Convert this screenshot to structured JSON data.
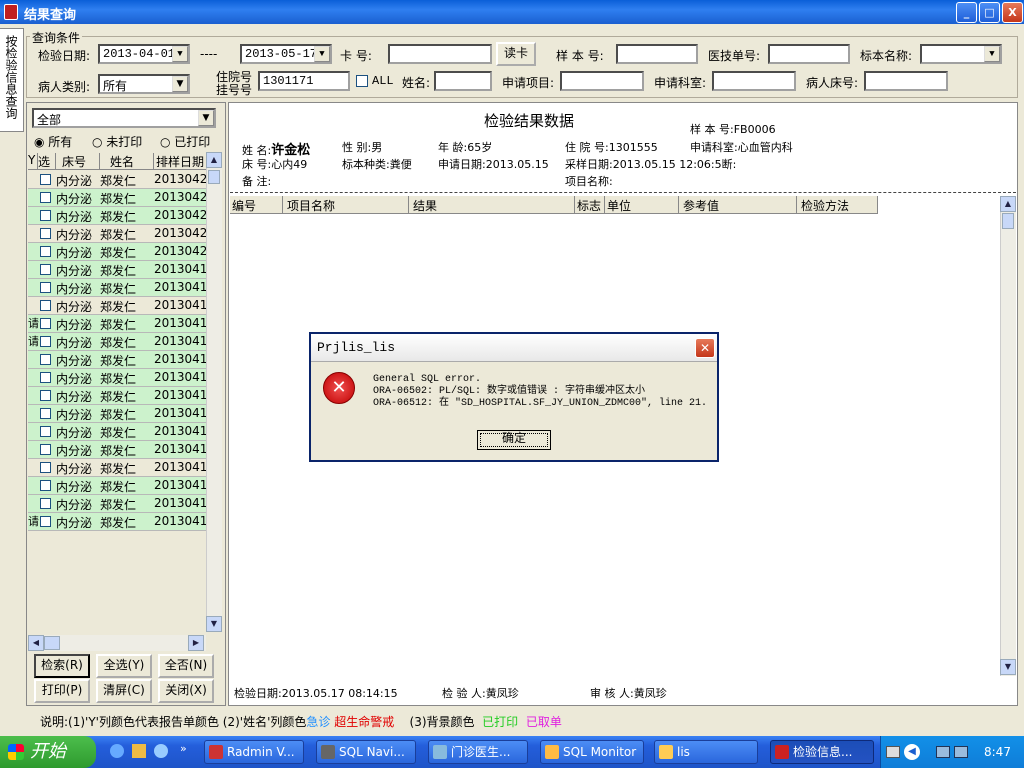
{
  "window": {
    "title": "结果查询",
    "min": "_",
    "max": "□",
    "close": "X"
  },
  "vtab": "按检验信息查询",
  "group_title": "查询条件",
  "row1": {
    "date_label": "检验日期:",
    "date_from": "2013-04-01",
    "dash": "----",
    "date_to": "2013-05-17",
    "card_label": "卡  号:",
    "card_value": "",
    "read_card": "读卡",
    "sample_label": "样 本 号:",
    "sample_value": "",
    "tech_label": "医技单号:",
    "tech_value": "",
    "specimen_label": "标本名称:",
    "specimen_value": ""
  },
  "row2": {
    "patient_type_label": "病人类别:",
    "patient_type": "所有",
    "hosp_label_top": "住院号",
    "hosp_label_bottom": "挂号号",
    "hosp_value": "1301171",
    "all_label": "ALL",
    "name_label": "姓名:",
    "name_value": "",
    "req_item_label": "申请项目:",
    "req_item_value": "",
    "req_dept_label": "申请科室:",
    "req_dept_value": "",
    "bed_label": "病人床号:",
    "bed_value": ""
  },
  "left": {
    "dept": "全部",
    "radio_all": "所有",
    "radio_unprinted": "未打印",
    "radio_printed": "已打印",
    "headers": [
      "Y",
      "选",
      "床号",
      "姓名",
      "排样日期"
    ],
    "rows": [
      {
        "y": "",
        "bed": "内分泌",
        "name": "郑发仁",
        "date": "2013042",
        "color": "b"
      },
      {
        "y": "",
        "bed": "内分泌",
        "name": "郑发仁",
        "date": "2013042",
        "color": "g"
      },
      {
        "y": "",
        "bed": "内分泌",
        "name": "郑发仁",
        "date": "2013042",
        "color": "g"
      },
      {
        "y": "",
        "bed": "内分泌",
        "name": "郑发仁",
        "date": "2013042",
        "color": "b"
      },
      {
        "y": "",
        "bed": "内分泌",
        "name": "郑发仁",
        "date": "2013042",
        "color": "g"
      },
      {
        "y": "",
        "bed": "内分泌",
        "name": "郑发仁",
        "date": "2013041",
        "color": "g"
      },
      {
        "y": "",
        "bed": "内分泌",
        "name": "郑发仁",
        "date": "2013041",
        "color": "g"
      },
      {
        "y": "",
        "bed": "内分泌",
        "name": "郑发仁",
        "date": "2013041",
        "color": "b"
      },
      {
        "y": "请",
        "bed": "内分泌",
        "name": "郑发仁",
        "date": "2013041",
        "color": "g"
      },
      {
        "y": "请",
        "bed": "内分泌",
        "name": "郑发仁",
        "date": "2013041",
        "color": "g"
      },
      {
        "y": "",
        "bed": "内分泌",
        "name": "郑发仁",
        "date": "2013041",
        "color": "g"
      },
      {
        "y": "",
        "bed": "内分泌",
        "name": "郑发仁",
        "date": "2013041",
        "color": "g"
      },
      {
        "y": "",
        "bed": "内分泌",
        "name": "郑发仁",
        "date": "2013041",
        "color": "g"
      },
      {
        "y": "",
        "bed": "内分泌",
        "name": "郑发仁",
        "date": "2013041",
        "color": "g"
      },
      {
        "y": "",
        "bed": "内分泌",
        "name": "郑发仁",
        "date": "2013041",
        "color": "g"
      },
      {
        "y": "",
        "bed": "内分泌",
        "name": "郑发仁",
        "date": "2013041",
        "color": "g"
      },
      {
        "y": "",
        "bed": "内分泌",
        "name": "郑发仁",
        "date": "2013041",
        "color": "b"
      },
      {
        "y": "",
        "bed": "内分泌",
        "name": "郑发仁",
        "date": "2013041",
        "color": "g"
      },
      {
        "y": "",
        "bed": "内分泌",
        "name": "郑发仁",
        "date": "2013041",
        "color": "g"
      },
      {
        "y": "请",
        "bed": "内分泌",
        "name": "郑发仁",
        "date": "2013041",
        "color": "g"
      }
    ],
    "btn_search": "检索(R)",
    "btn_select_all": "全选(Y)",
    "btn_select_none": "全否(N)",
    "btn_print": "打印(P)",
    "btn_clear": "清屏(C)",
    "btn_close": "关闭(X)"
  },
  "main": {
    "title": "检验结果数据",
    "sample_no_label": "样 本 号:",
    "sample_no": "FB0006",
    "name_label": "姓    名:",
    "name": "许金松",
    "sex_label": "性    别:",
    "sex": "男",
    "age_label": "年    龄:",
    "age": "65岁",
    "inpatient_label": "住 院 号:",
    "inpatient": "1301555",
    "req_dept_label": "申请科室:",
    "req_dept": "心血管内科",
    "bed_label": "床    号:",
    "bed": "心内49",
    "specimen_label": "标本种类:",
    "specimen": "粪便",
    "req_date_label": "申请日期:",
    "req_date": "2013.05.15",
    "collect_label": "采样日期:",
    "collect": "2013.05.15 12:06:5断:",
    "note_label": "备    注:",
    "item_name_label": "项目名称:",
    "cols": [
      "编号",
      "项目名称",
      "结果",
      "标志",
      "单位",
      "参考值",
      "检验方法"
    ],
    "footer_date_label": "检验日期:",
    "footer_date": "2013.05.17 08:14:15",
    "tester_label": "检 验 人:",
    "tester": "黄凤珍",
    "reviewer_label": "审 核 人:",
    "reviewer": "黄凤珍"
  },
  "legend": {
    "p1": "说明:(1)'Y'列颜色代表报告单颜色  (2)'姓名'列颜色",
    "urgent": "急诊",
    "critical": "超生命警戒",
    "p3": "(3)背景颜色",
    "printed": "已打印",
    "cancelled": "已取单"
  },
  "dialog": {
    "title": "Prjlis_lis",
    "line1": "General SQL error.",
    "line2": "ORA-06502: PL/SQL: 数字或值错误 :  字符串缓冲区太小",
    "line3": "ORA-06512: 在 \"SD_HOSPITAL.SF_JY_UNION_ZDMC00\", line 21.",
    "ok": "确定"
  },
  "taskbar": {
    "start": "开始",
    "items": [
      "Radmin V...",
      "SQL Navi...",
      "门诊医生...",
      "SQL Monitor",
      "lis",
      "检验信息..."
    ],
    "clock": "8:47"
  },
  "colors": {
    "green_row": "#ccf2cc",
    "urgent": "#1f8fff",
    "critical": "#e00000",
    "printed": "#22cc22",
    "cancelled": "#e020e0"
  }
}
